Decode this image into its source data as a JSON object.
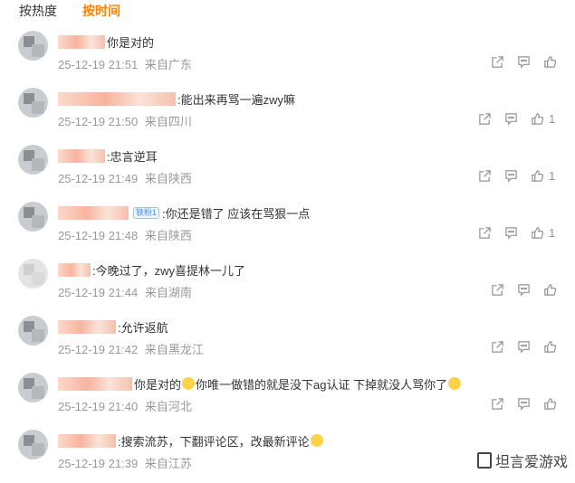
{
  "tabs": [
    {
      "label": "按热度",
      "active": false
    },
    {
      "label": "按时间",
      "active": true
    }
  ],
  "comments": [
    {
      "text": "你是对的",
      "date": "25-12-19 21:51",
      "source": "来自广东",
      "likes": ""
    },
    {
      "text": ":能出来再骂一遍zwy嘛",
      "date": "25-12-19 21:50",
      "source": "来自四川",
      "likes": "1"
    },
    {
      "text": ":忠言逆耳",
      "date": "25-12-19 21:49",
      "source": "来自陕西",
      "likes": "1"
    },
    {
      "badge": "铁粉1",
      "text": ":你还是错了 应该在骂狠一点",
      "date": "25-12-19 21:48",
      "source": "来自陕西",
      "likes": "1"
    },
    {
      "text": ":今晚过了，zwy喜提林一儿了",
      "date": "25-12-19 21:44",
      "source": "来自湖南",
      "likes": ""
    },
    {
      "text": ":允许返航",
      "date": "25-12-19 21:42",
      "source": "来自黑龙江",
      "likes": ""
    },
    {
      "text": "你是对的",
      "text2": "你唯一做错的就是没下ag认证 下掉就没人骂你了",
      "date": "25-12-19 21:40",
      "source": "来自河北",
      "likes": ""
    },
    {
      "text": ":搜索流苏，下翻评论区，改最新评论",
      "date": "25-12-19 21:39",
      "source": "来自江苏",
      "likes": ""
    }
  ],
  "watermark": "坦言爱游戏",
  "icons": {
    "share": "share-icon",
    "comment": "comment-icon",
    "like": "thumbs-up-icon"
  },
  "colors": {
    "accent": "#ff8200",
    "meta": "#999999",
    "icon": "#939393"
  }
}
